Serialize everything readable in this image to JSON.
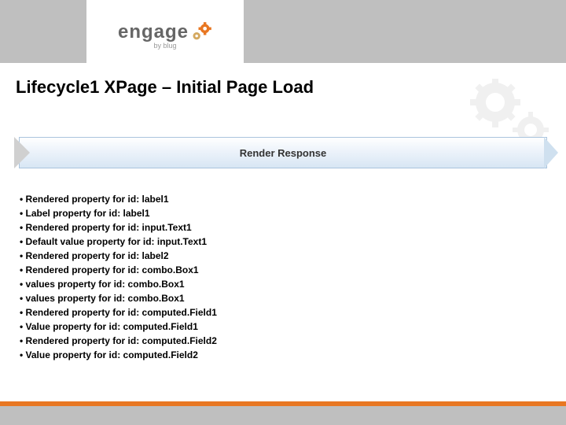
{
  "logo": {
    "text": "engage",
    "subtext": "by blug"
  },
  "title": "Lifecycle1 XPage – Initial Page Load",
  "banner": {
    "label": "Render Response"
  },
  "bullets": [
    "• Rendered property for id: label1",
    "• Label property for id: label1",
    "• Rendered property for id: input.Text1",
    "• Default value property for id: input.Text1",
    "• Rendered property for id: label2",
    "• Rendered property for id: combo.Box1",
    "• values property for id: combo.Box1",
    "• values property for id: combo.Box1",
    "• Rendered property for id: computed.Field1",
    "• Value property for id: computed.Field1",
    "• Rendered property for id: computed.Field2",
    "• Value property for id: computed.Field2"
  ],
  "colors": {
    "accent": "#e87722",
    "gray": "#bfbfbf"
  }
}
